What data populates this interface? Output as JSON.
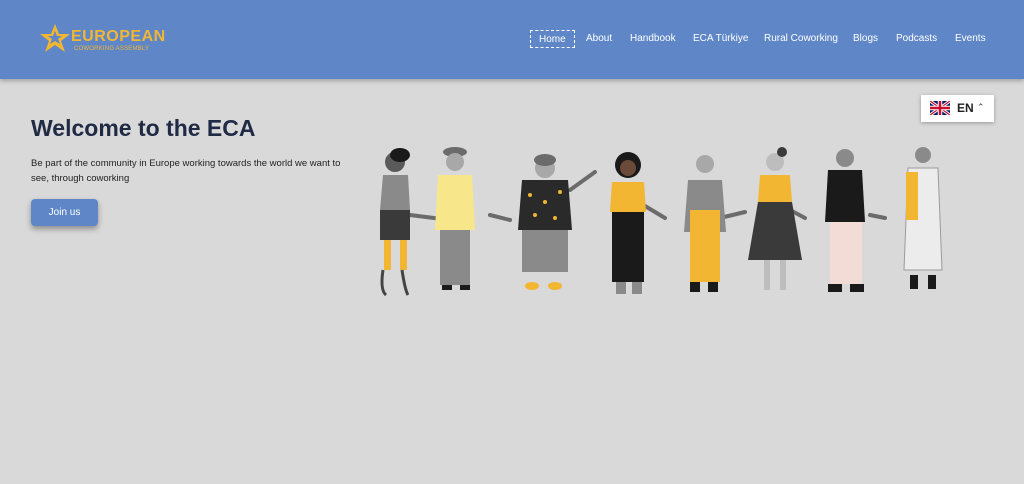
{
  "logo": {
    "title": "EUROPEAN",
    "subtitle": "COWORKING ASSEMBLY",
    "icon": "star-icon",
    "color": "#f2b632"
  },
  "nav": {
    "items": [
      {
        "label": "Home",
        "active": true
      },
      {
        "label": "About",
        "active": false
      },
      {
        "label": "Handbook",
        "active": false
      },
      {
        "label": "ECA Türkiye",
        "active": false
      },
      {
        "label": "Rural Coworking",
        "active": false
      },
      {
        "label": "Blogs",
        "active": false
      },
      {
        "label": "Podcasts",
        "active": false
      },
      {
        "label": "Events",
        "active": false
      }
    ]
  },
  "language": {
    "label": "EN",
    "icon": "uk-flag-icon",
    "chevron": "chevron-up-icon"
  },
  "hero": {
    "title": "Welcome to the ECA",
    "text": "Be part of the community in Europe working towards the world we want to see, through coworking",
    "button": "Join us"
  },
  "colors": {
    "header": "#5f87c7",
    "background": "#d9d9d9",
    "accent": "#f2b632",
    "title": "#1f2a44"
  }
}
